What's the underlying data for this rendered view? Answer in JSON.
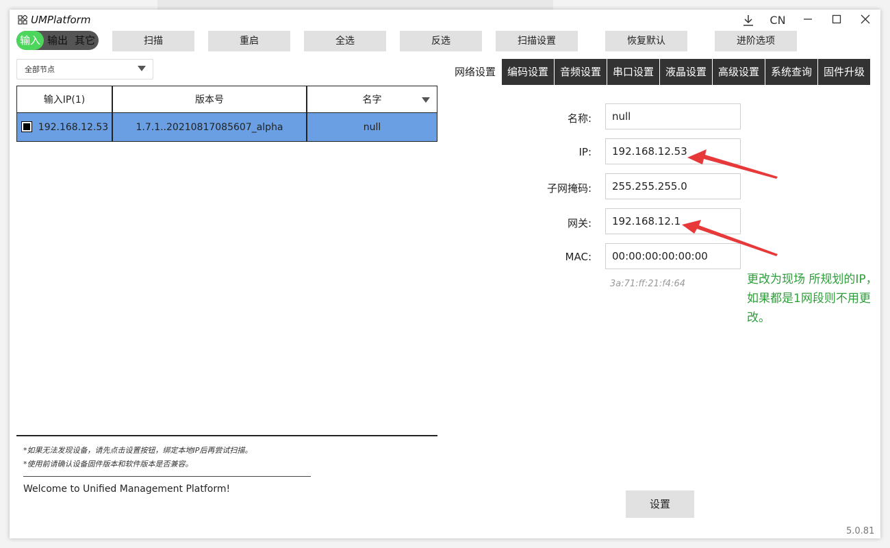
{
  "app": {
    "title": "UMPlatform"
  },
  "window_controls": {
    "download_icon": "download-icon",
    "language": "CN",
    "minimize_icon": "minimize-icon",
    "maximize_icon": "maximize-icon",
    "close_icon": "close-icon"
  },
  "mode_toggle": {
    "input": "输入",
    "output": "输出",
    "other": "其它",
    "active": "输入",
    "active_color": "#4dd65c"
  },
  "toolbar": {
    "scan": "扫描",
    "restart": "重启",
    "select_all": "全选",
    "invert": "反选",
    "scan_settings": "扫描设置",
    "restore_default": "恢复默认",
    "advanced": "进阶选项"
  },
  "node_filter": {
    "value": "全部节点"
  },
  "table": {
    "columns": [
      "输入IP(1)",
      "版本号",
      "名字"
    ],
    "rows": [
      {
        "ip": "192.168.12.53",
        "version": "1.7.1..20210817085607_alpha",
        "name": "null",
        "selected": true
      }
    ],
    "row_highlight_color": "#6b9fe3"
  },
  "notes": {
    "line1": "*如果无法发现设备，请先点击设置按钮，绑定本地IP后再尝试扫描。",
    "line2": "*使用前请确认设备固件版本和软件版本是否兼容。",
    "log": "Welcome to Unified Management Platform!"
  },
  "tabs": [
    {
      "label": "网络设置",
      "active": true
    },
    {
      "label": "编码设置",
      "active": false
    },
    {
      "label": "音频设置",
      "active": false
    },
    {
      "label": "串口设置",
      "active": false
    },
    {
      "label": "液晶设置",
      "active": false
    },
    {
      "label": "高级设置",
      "active": false
    },
    {
      "label": "系统查询",
      "active": false
    },
    {
      "label": "固件升级",
      "active": false
    }
  ],
  "form": {
    "name_label": "名称:",
    "name_value": "null",
    "ip_label": "IP:",
    "ip_value": "192.168.12.53",
    "subnet_label": "子网掩码:",
    "subnet_value": "255.255.255.0",
    "gateway_label": "网关:",
    "gateway_value": "192.168.12.1",
    "mac_label": "MAC:",
    "mac_value": "00:00:00:00:00:00",
    "mac_hint": "3a:71:ff:21:f4:64"
  },
  "annotation": {
    "text": "更改为现场 所规划的IP，如果都是1网段则不用更改。",
    "color": "#2e9e3a",
    "arrow_color": "#e8393a"
  },
  "set_button": "设置",
  "version": "5.0.81"
}
